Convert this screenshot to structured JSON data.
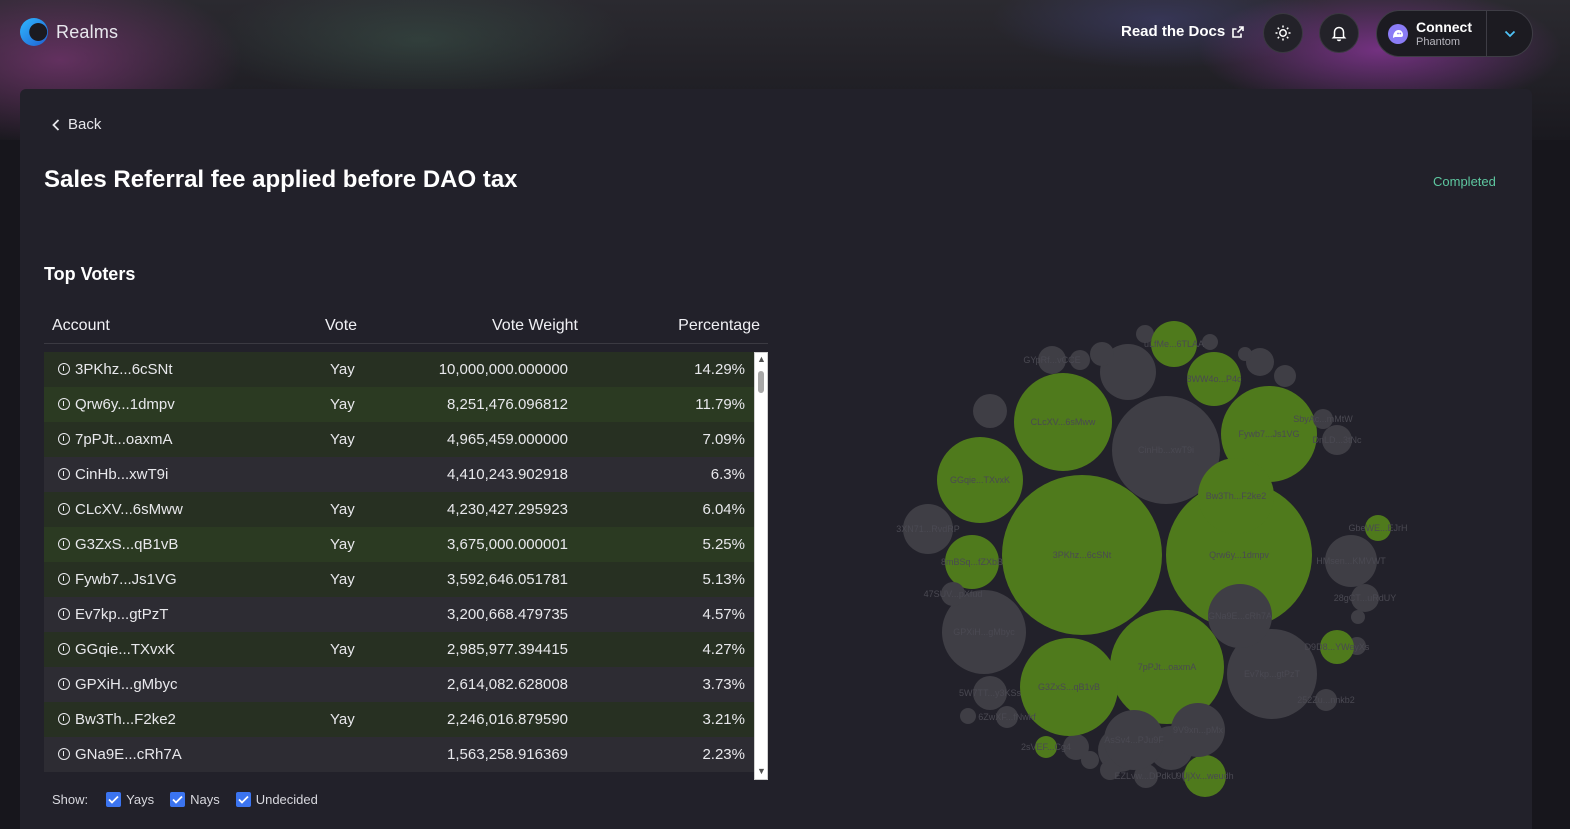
{
  "header": {
    "app_name": "Realms",
    "docs_link": "Read the Docs",
    "connect_title": "Connect",
    "connect_sub": "Phantom"
  },
  "proposal": {
    "back_label": "Back",
    "title": "Sales Referral fee applied before DAO tax",
    "status": "Completed"
  },
  "voters": {
    "section_title": "Top Voters",
    "columns": [
      "Account",
      "Vote",
      "Vote Weight",
      "Percentage"
    ],
    "rows": [
      {
        "account": "3PKhz...6cSNt",
        "vote": "Yay",
        "weight": "10,000,000.000000",
        "pct": "14.29%"
      },
      {
        "account": "Qrw6y...1dmpv",
        "vote": "Yay",
        "weight": "8,251,476.096812",
        "pct": "11.79%"
      },
      {
        "account": "7pPJt...oaxmA",
        "vote": "Yay",
        "weight": "4,965,459.000000",
        "pct": "7.09%"
      },
      {
        "account": "CinHb...xwT9i",
        "vote": "",
        "weight": "4,410,243.902918",
        "pct": "6.3%"
      },
      {
        "account": "CLcXV...6sMww",
        "vote": "Yay",
        "weight": "4,230,427.295923",
        "pct": "6.04%"
      },
      {
        "account": "G3ZxS...qB1vB",
        "vote": "Yay",
        "weight": "3,675,000.000001",
        "pct": "5.25%"
      },
      {
        "account": "Fywb7...Js1VG",
        "vote": "Yay",
        "weight": "3,592,646.051781",
        "pct": "5.13%"
      },
      {
        "account": "Ev7kp...gtPzT",
        "vote": "",
        "weight": "3,200,668.479735",
        "pct": "4.57%"
      },
      {
        "account": "GGqie...TXvxK",
        "vote": "Yay",
        "weight": "2,985,977.394415",
        "pct": "4.27%"
      },
      {
        "account": "GPXiH...gMbyc",
        "vote": "",
        "weight": "2,614,082.628008",
        "pct": "3.73%"
      },
      {
        "account": "Bw3Th...F2ke2",
        "vote": "Yay",
        "weight": "2,246,016.879590",
        "pct": "3.21%"
      },
      {
        "account": "GNa9E...cRh7A",
        "vote": "",
        "weight": "1,563,258.916369",
        "pct": "2.23%"
      }
    ]
  },
  "filters": {
    "show_label": "Show:",
    "yays": "Yays",
    "nays": "Nays",
    "undecided": "Undecided"
  },
  "bubble_chart": {
    "colors": {
      "yay": "#4f7a1c",
      "undecided": "#3f3e45"
    },
    "bubbles": [
      {
        "label": "3PKhz...6cSNt",
        "vote": "yay"
      },
      {
        "label": "Qrw6y...1dmpv",
        "vote": "yay"
      },
      {
        "label": "7pPJt...oaxmA",
        "vote": "yay"
      },
      {
        "label": "CinHb...xwT9i",
        "vote": "undecided"
      },
      {
        "label": "CLcXV...6sMww",
        "vote": "yay"
      },
      {
        "label": "G3ZxS...qB1vB",
        "vote": "yay"
      },
      {
        "label": "Fywb7...Js1VG",
        "vote": "yay"
      },
      {
        "label": "Ev7kp...gtPzT",
        "vote": "undecided"
      },
      {
        "label": "GGqie...TXvxK",
        "vote": "yay"
      },
      {
        "label": "GPXiH...gMbyc",
        "vote": "undecided"
      },
      {
        "label": "Bw3Th...F2ke2",
        "vote": "yay"
      },
      {
        "label": "GNa9E...cRh7A",
        "vote": "undecided"
      },
      {
        "label": "HMsen...KMVWT",
        "vote": "undecided"
      },
      {
        "label": "8mBSq...fZXbB",
        "vote": "yay"
      },
      {
        "label": "3XN71...RvdRP",
        "vote": "undecided"
      },
      {
        "label": "GYpRf...vCCE",
        "vote": "undecided"
      },
      {
        "label": "uLfMe...6TLAA",
        "vote": "yay"
      },
      {
        "label": "8WW4o...P4c",
        "vote": "yay"
      },
      {
        "label": "DnLD...3tNc",
        "vote": "undecided"
      },
      {
        "label": "6ZwXF...fNwkf",
        "vote": "undecided"
      },
      {
        "label": "5W7TT...y3KSs",
        "vote": "undecided"
      },
      {
        "label": "47SUV...pXfud",
        "vote": "undecided"
      },
      {
        "label": "EZLvw...DPdkU",
        "vote": "undecided"
      },
      {
        "label": "9UjXv...weudh",
        "vote": "yay"
      },
      {
        "label": "2sVEF...Cg4",
        "vote": "yay"
      },
      {
        "label": "28gCT...uRdUY",
        "vote": "undecided"
      },
      {
        "label": "252Zu...nnkb2",
        "vote": "undecided"
      },
      {
        "label": "AsSv4...PJu9F",
        "vote": "undecided"
      },
      {
        "label": "9V9xn...pMx",
        "vote": "undecided"
      },
      {
        "label": "D9D8...YWeyXs",
        "vote": "yay"
      },
      {
        "label": "GbeWE...EJrH",
        "vote": "yay"
      },
      {
        "label": "SbyAc...mMtW",
        "vote": "undecided"
      }
    ]
  }
}
